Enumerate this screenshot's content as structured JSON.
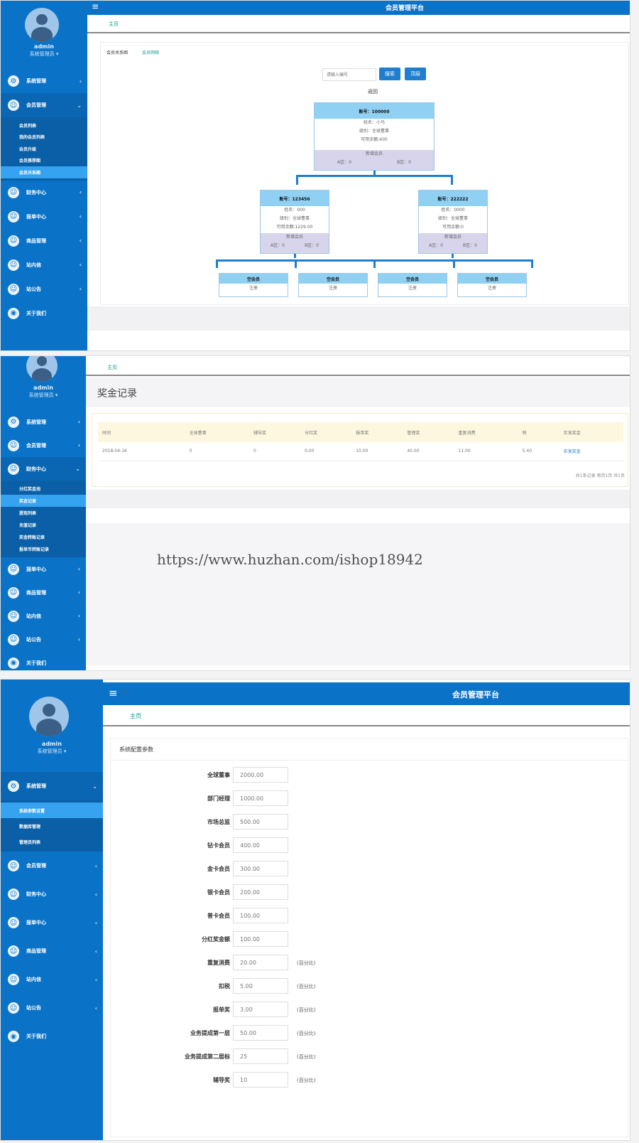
{
  "app": {
    "title": "会员管理平台",
    "menu_toggle": "≡"
  },
  "user": {
    "name": "admin",
    "role": "系统管理员 ▾"
  },
  "breadcrumb": {
    "home": "主页"
  },
  "menus": {
    "screen1": [
      {
        "label": "系统管理",
        "icon": "⚙",
        "arrow": "‹"
      },
      {
        "label": "会员管理",
        "icon": "☺",
        "arrow": "⌄"
      },
      {
        "label": "财务中心",
        "icon": "☺",
        "arrow": "‹"
      },
      {
        "label": "报单中心",
        "icon": "☺",
        "arrow": "‹"
      },
      {
        "label": "商品管理",
        "icon": "☺",
        "arrow": "‹"
      },
      {
        "label": "站内信",
        "icon": "☺",
        "arrow": "‹"
      },
      {
        "label": "站公告",
        "icon": "☺",
        "arrow": "‹"
      },
      {
        "label": "关于我们",
        "icon": "◉",
        "arrow": ""
      }
    ],
    "screen1_sub": [
      "会员列表",
      "我的会员列表",
      "会员升级",
      "会员推荐图",
      "会员关系图"
    ],
    "screen2": [
      {
        "label": "系统管理",
        "icon": "⚙",
        "arrow": "‹"
      },
      {
        "label": "会员管理",
        "icon": "☺",
        "arrow": "‹"
      },
      {
        "label": "财务中心",
        "icon": "☺",
        "arrow": "⌄"
      },
      {
        "label": "报单中心",
        "icon": "☺",
        "arrow": "‹"
      },
      {
        "label": "商品管理",
        "icon": "☺",
        "arrow": "‹"
      },
      {
        "label": "站内信",
        "icon": "☺",
        "arrow": "‹"
      },
      {
        "label": "站公告",
        "icon": "☺",
        "arrow": "‹"
      },
      {
        "label": "关于我们",
        "icon": "◉",
        "arrow": ""
      }
    ],
    "screen2_sub": [
      "分红奖金池",
      "奖金记录",
      "提现列表",
      "充值记录",
      "奖金转账记录",
      "报单币转账记录"
    ],
    "screen3": [
      {
        "label": "系统管理",
        "icon": "⚙",
        "arrow": "⌄"
      },
      {
        "label": "会员管理",
        "icon": "☺",
        "arrow": "‹"
      },
      {
        "label": "财务中心",
        "icon": "☺",
        "arrow": "‹"
      },
      {
        "label": "报单中心",
        "icon": "☺",
        "arrow": "‹"
      },
      {
        "label": "商品管理",
        "icon": "☺",
        "arrow": "‹"
      },
      {
        "label": "站内信",
        "icon": "☺",
        "arrow": "‹"
      },
      {
        "label": "站公告",
        "icon": "☺",
        "arrow": "‹"
      },
      {
        "label": "关于我们",
        "icon": "◉",
        "arrow": ""
      }
    ],
    "screen3_sub": [
      "系统参数设置",
      "数据库管理",
      "管理员列表"
    ]
  },
  "tree": {
    "tab_recommend": "会员关系图",
    "tab_relation": "会员网络",
    "search_placeholder": "请输入编号",
    "search_button": "搜索",
    "home_button": "顶层",
    "back_link": "返回",
    "root": {
      "id": "账号：100000",
      "name": "姓名：小马",
      "level": "级别：全球董事",
      "balance": "可用余额:400",
      "footer": "新增会员",
      "left": "A区：0",
      "right": "B区：0"
    },
    "children": [
      {
        "id": "账号：123456",
        "name": "姓名：000",
        "level": "级别：全球董事",
        "balance": "可用余额:1229.00",
        "footer": "新增会员",
        "left": "A区：0",
        "right": "B区：0"
      },
      {
        "id": "账号：222222",
        "name": "姓名：0000",
        "level": "级别：全球董事",
        "balance": "可用余额:0",
        "footer": "新增会员",
        "left": "A区：0",
        "right": "B区：0"
      }
    ],
    "empty_slot": {
      "title": "空会员",
      "action": "注册"
    }
  },
  "bonus": {
    "title": "奖金记录",
    "columns": [
      "时间",
      "全球董事",
      "辅导奖",
      "分红奖",
      "报单奖",
      "管理奖",
      "重复消费",
      "税",
      "实发奖金"
    ],
    "rows": [
      [
        "2018-04-16",
        "0",
        "0",
        "0.00",
        "10.00",
        "40.00",
        "11.00",
        "5.40",
        "实发奖金"
      ]
    ],
    "pager": "共1条记录 每页1页 共1页"
  },
  "watermark": "https://www.huzhan.com/ishop18942",
  "settings": {
    "title": "系统配置参数",
    "fields": [
      {
        "label": "全球董事",
        "value": "2000.00",
        "unit": ""
      },
      {
        "label": "部门经理",
        "value": "1000.00",
        "unit": ""
      },
      {
        "label": "市场总监",
        "value": "500.00",
        "unit": ""
      },
      {
        "label": "钻卡会员",
        "value": "400.00",
        "unit": ""
      },
      {
        "label": "金卡会员",
        "value": "300.00",
        "unit": ""
      },
      {
        "label": "银卡会员",
        "value": "200.00",
        "unit": ""
      },
      {
        "label": "普卡会员",
        "value": "100.00",
        "unit": ""
      },
      {
        "label": "分红奖金额",
        "value": "100.00",
        "unit": ""
      },
      {
        "label": "重复消费",
        "value": "20.00",
        "unit": "(百分比)"
      },
      {
        "label": "扣税",
        "value": "5.00",
        "unit": "(百分比)"
      },
      {
        "label": "报单奖",
        "value": "3.00",
        "unit": "(百分比)"
      },
      {
        "label": "业务提成第一层",
        "value": "50.00",
        "unit": "(百分比)"
      },
      {
        "label": "业务提成第二层标",
        "value": "25",
        "unit": "(百分比)"
      },
      {
        "label": "辅导奖",
        "value": "10",
        "unit": "(百分比)"
      }
    ]
  }
}
